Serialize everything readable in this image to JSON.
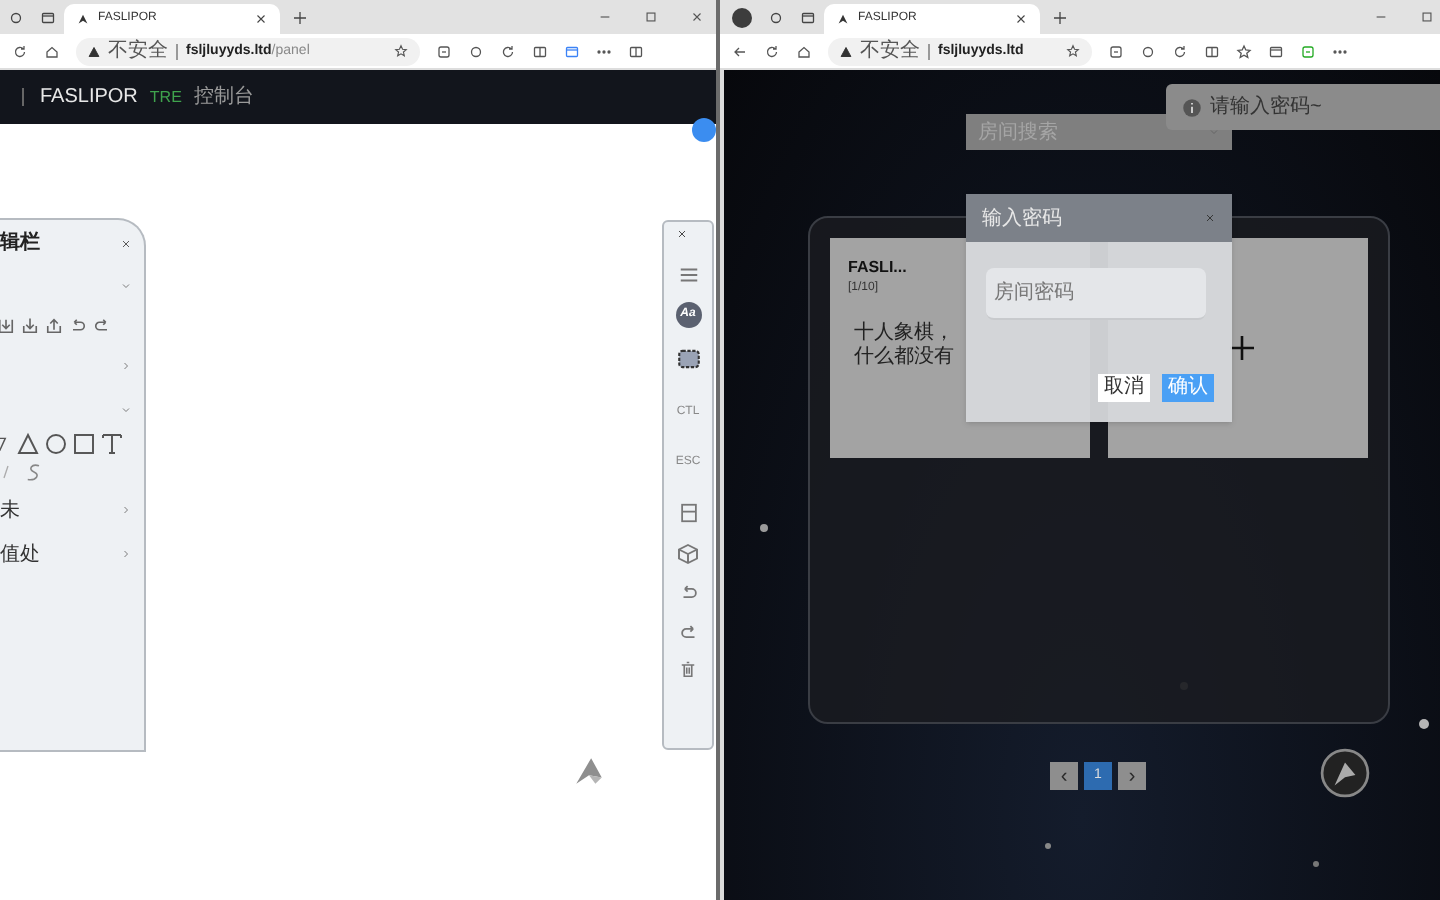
{
  "left_browser": {
    "tab": {
      "title": "FASLIPOR",
      "selected": true
    },
    "address": {
      "security": "不安全",
      "host": "fsljluyyds.ltd",
      "path": "/panel"
    }
  },
  "left_app": {
    "header": {
      "brand": "FASLIPOR",
      "tag": "TRE",
      "nav": "控制台"
    },
    "edit_panel": {
      "title": "辑栏",
      "rows": [
        {
          "kind": "group",
          "expanded": true
        },
        {
          "kind": "tools"
        },
        {
          "kind": "group",
          "expanded": false
        },
        {
          "kind": "group",
          "expanded": true
        },
        {
          "kind": "shapes"
        },
        {
          "kind": "group",
          "label": "未",
          "expanded": false
        },
        {
          "kind": "group",
          "label": "值处",
          "expanded": false
        }
      ]
    },
    "toolbar": [
      {
        "kind": "close"
      },
      {
        "kind": "menu"
      },
      {
        "kind": "font",
        "label": "Aa"
      },
      {
        "kind": "screen"
      },
      {
        "kind": "text",
        "label": "CTL"
      },
      {
        "kind": "text",
        "label": "ESC"
      },
      {
        "kind": "save"
      },
      {
        "kind": "cube"
      },
      {
        "kind": "undo"
      },
      {
        "kind": "redo"
      },
      {
        "kind": "trash"
      }
    ]
  },
  "right_browser": {
    "tab": {
      "title": "FASLIPOR",
      "selected": true
    },
    "address": {
      "security": "不安全",
      "host": "fsljluyyds.ltd"
    }
  },
  "right_app": {
    "room_search": {
      "placeholder": "房间搜索"
    },
    "rooms": [
      {
        "kind": "room",
        "name": "FASLI...",
        "count": "[1/10]",
        "description": "十人象棋，什么都没有"
      },
      {
        "kind": "add"
      }
    ],
    "pagination": {
      "prev": "‹",
      "pages": [
        {
          "label": "1",
          "selected": true
        }
      ],
      "next": "›"
    },
    "toast": {
      "message": "请输入密码~"
    },
    "dialog": {
      "title": "输入密码",
      "field": {
        "placeholder": "房间密码"
      },
      "buttons": [
        {
          "label": "取消",
          "kind": "secondary"
        },
        {
          "label": "确认",
          "kind": "primary"
        }
      ]
    }
  }
}
